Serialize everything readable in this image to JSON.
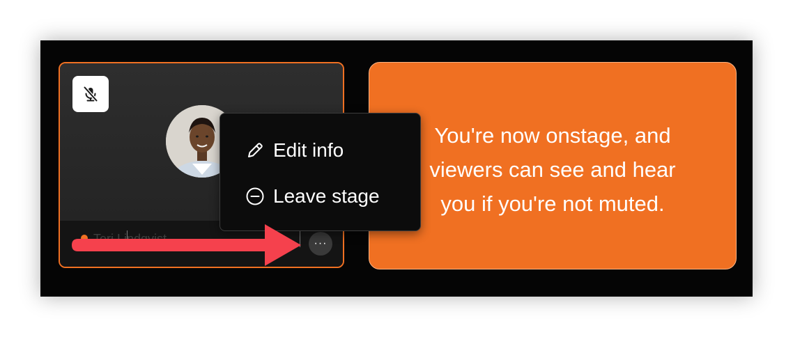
{
  "participant": {
    "name": "Teri Lindqvist",
    "more_glyph": "···",
    "mute_icon": "microphone-off-icon",
    "status_color": "#f07022"
  },
  "context_menu": {
    "items": [
      {
        "label": "Edit info",
        "icon": "pencil-icon"
      },
      {
        "label": "Leave stage",
        "icon": "minus-circle-icon"
      }
    ]
  },
  "onstage_notice": {
    "lines": [
      "You're now onstage, and",
      "viewers can see and hear",
      "you if you're not muted."
    ]
  },
  "colors": {
    "accent": "#f07022",
    "arrow": "#f5414d",
    "background": "#050505"
  }
}
